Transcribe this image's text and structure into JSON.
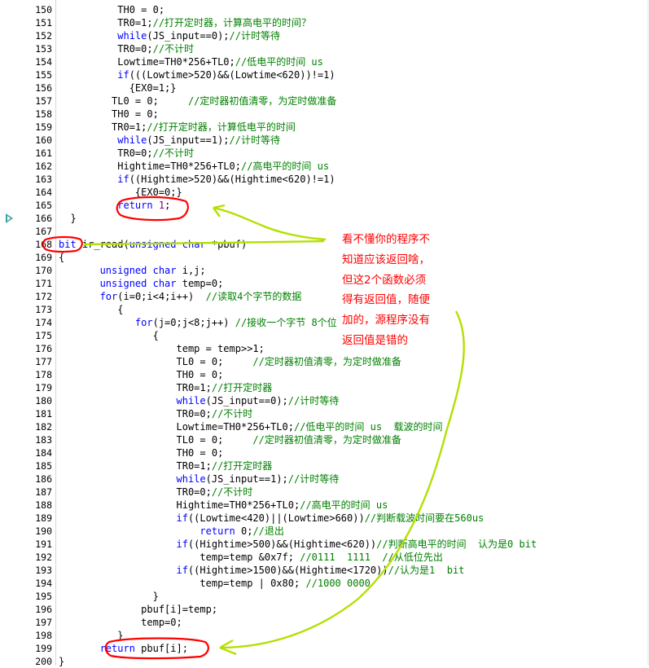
{
  "editor": {
    "lines": [
      {
        "n": "150",
        "code": "          <span class=\"kw\"></span>TH0 = 0;"
      },
      {
        "n": "151",
        "code": "          TR0=1;<span class=\"cm\">//打开定时器，计算高电平的时间？</span>"
      },
      {
        "n": "152",
        "code": "          <span class=\"kw\">while</span>(JS_input==0);<span class=\"cm\">//计时等待</span>"
      },
      {
        "n": "153",
        "code": "          TR0=0;<span class=\"cm\">//不计时</span>"
      },
      {
        "n": "154",
        "code": "          Lowtime=TH0*256+TL0;<span class=\"cm\">//低电平的时间 us</span>"
      },
      {
        "n": "155",
        "code": "          <span class=\"kw\">if</span>(((Lowtime&gt;520)&amp;&amp;(Lowtime&lt;620))!=1)"
      },
      {
        "n": "156",
        "code": "            {EX0=1;}"
      },
      {
        "n": "157",
        "code": "         TL0 = 0;     <span class=\"cm\">//定时器初值清零，为定时做准备</span>"
      },
      {
        "n": "158",
        "code": "         TH0 = 0;"
      },
      {
        "n": "159",
        "code": "         TR0=1;<span class=\"cm\">//打开定时器，计算低电平的时间</span>"
      },
      {
        "n": "160",
        "code": "          <span class=\"kw\">while</span>(JS_input==1);<span class=\"cm\">//计时等待</span>"
      },
      {
        "n": "161",
        "code": "          TR0=0;<span class=\"cm\">//不计时</span>"
      },
      {
        "n": "162",
        "code": "          Hightime=TH0*256+TL0;<span class=\"cm\">//高电平的时间 us</span>"
      },
      {
        "n": "163",
        "code": "          <span class=\"kw\">if</span>((Hightime&gt;520)&amp;&amp;(Hightime&lt;620)!=1)"
      },
      {
        "n": "164",
        "code": "             {EX0=0;}"
      },
      {
        "n": "165",
        "code": "          <span class=\"kw\">return</span> <span class=\"nm\">1</span>;"
      },
      {
        "n": "166",
        "code": "  }"
      },
      {
        "n": "167",
        "code": ""
      },
      {
        "n": "168",
        "code": "<span class=\"kw\">bit</span> ir_read(<span class=\"kw\">unsigned char</span> *pbuf)"
      },
      {
        "n": "169",
        "code": "{"
      },
      {
        "n": "170",
        "code": "       <span class=\"kw\">unsigned char</span> i,j;"
      },
      {
        "n": "171",
        "code": "       <span class=\"kw\">unsigned char</span> temp=0;"
      },
      {
        "n": "172",
        "code": "       <span class=\"kw\">for</span>(i=0;i&lt;4;i++)  <span class=\"cm\">//读取4个字节的数据</span>"
      },
      {
        "n": "173",
        "code": "          {"
      },
      {
        "n": "174",
        "code": "             <span class=\"kw\">for</span>(j=0;j&lt;8;j++) <span class=\"cm\">//接收一个字节 8个位</span>"
      },
      {
        "n": "175",
        "code": "                {"
      },
      {
        "n": "176",
        "code": "                    temp = temp&gt;&gt;1;"
      },
      {
        "n": "177",
        "code": "                    TL0 = 0;     <span class=\"cm\">//定时器初值清零，为定时做准备</span>"
      },
      {
        "n": "178",
        "code": "                    TH0 = 0;"
      },
      {
        "n": "179",
        "code": "                    TR0=1;<span class=\"cm\">//打开定时器</span>"
      },
      {
        "n": "180",
        "code": "                    <span class=\"kw\">while</span>(JS_input==0);<span class=\"cm\">//计时等待</span>"
      },
      {
        "n": "181",
        "code": "                    TR0=0;<span class=\"cm\">//不计时</span>"
      },
      {
        "n": "182",
        "code": "                    Lowtime=TH0*256+TL0;<span class=\"cm\">//低电平的时间 us  载波的时间</span>"
      },
      {
        "n": "183",
        "code": "                    TL0 = 0;     <span class=\"cm\">//定时器初值清零，为定时做准备</span>"
      },
      {
        "n": "184",
        "code": "                    TH0 = 0;"
      },
      {
        "n": "185",
        "code": "                    TR0=1;<span class=\"cm\">//打开定时器</span>"
      },
      {
        "n": "186",
        "code": "                    <span class=\"kw\">while</span>(JS_input==1);<span class=\"cm\">//计时等待</span>"
      },
      {
        "n": "187",
        "code": "                    TR0=0;<span class=\"cm\">//不计时</span>"
      },
      {
        "n": "188",
        "code": "                    Hightime=TH0*256+TL0;<span class=\"cm\">//高电平的时间 us</span>"
      },
      {
        "n": "189",
        "code": "                    <span class=\"kw\">if</span>((Lowtime&lt;420)||(Lowtime&gt;660))<span class=\"cm\">//判断载波时间要在560us</span>"
      },
      {
        "n": "190",
        "code": "                        <span class=\"kw\">return</span> 0;<span class=\"cm\">//退出</span>"
      },
      {
        "n": "191",
        "code": "                    <span class=\"kw\">if</span>((Hightime&gt;500)&amp;&amp;(Hightime&lt;620))<span class=\"cm\">//判断高电平的时间  认为是0 bit</span>"
      },
      {
        "n": "192",
        "code": "                        temp=temp &amp;0x7f; <span class=\"cm\">//0111  1111  //从低位先出</span>"
      },
      {
        "n": "193",
        "code": "                    <span class=\"kw\">if</span>((Hightime&gt;1500)&amp;&amp;(Hightime&lt;1720))<span class=\"cm\">//认为是1  bit</span>"
      },
      {
        "n": "194",
        "code": "                        temp=temp | 0x80; <span class=\"cm\">//1000 0000</span>"
      },
      {
        "n": "195",
        "code": "                }"
      },
      {
        "n": "196",
        "code": "              pbuf[i]=temp;"
      },
      {
        "n": "197",
        "code": "              temp=0;"
      },
      {
        "n": "198",
        "code": "          }"
      },
      {
        "n": "199",
        "code": "       <span class=\"kw\">return</span> pbuf[i];"
      },
      {
        "n": "200",
        "code": "}"
      }
    ],
    "marker_line": "166"
  },
  "annotation": {
    "note_lines": [
      "看不懂你的程序不",
      "知道应该返回啥，",
      "但这2个函数必须",
      "得有返回值，随便",
      "加的，源程序没有",
      "返回值是错的"
    ],
    "color": "#ff0000",
    "arrow_color": "#b3e000"
  },
  "colors": {
    "keyword": "#0000ff",
    "comment": "#008000",
    "number": "#800080",
    "text": "#000000"
  }
}
